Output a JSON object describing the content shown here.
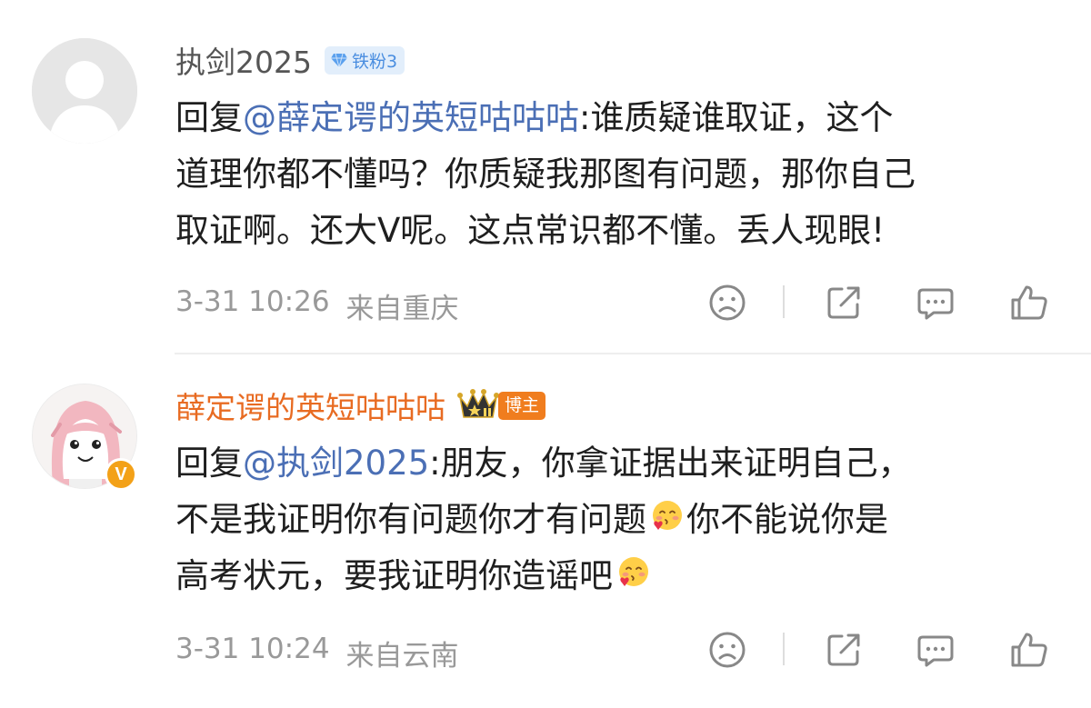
{
  "comments": [
    {
      "username": "执剑2025",
      "fan_badge": "铁粉3",
      "mention_prefix": "回复",
      "mention": "@薛定谔的英短咕咕咕",
      "lines": [
        ":谁质疑谁取证，这个",
        "道理你都不懂吗？你质疑我那图有问题，那你自己",
        "取证啊。还大V呢。这点常识都不懂。丢人现眼!"
      ],
      "time": "3-31 10:26",
      "location": "来自重庆"
    },
    {
      "username": "薛定谔的英短咕咕咕",
      "role_badge": "博主",
      "verified_mark": "V",
      "mention_prefix": "回复",
      "mention": "@执剑2025",
      "lines": [
        ":朋友，你拿证据出来证明自己，",
        "不是我证明你有问题你才有问题",
        "你不能说你是",
        "高考状元，要我证明你造谣吧"
      ],
      "time": "3-31 10:24",
      "location": "来自云南"
    }
  ],
  "icons": {
    "avatar_default": "default-avatar-icon",
    "gem": "diamond-icon",
    "crown": "crown-icon",
    "dislike": "sad-face-icon",
    "share": "share-icon",
    "reply": "comment-icon",
    "like": "thumbs-up-icon",
    "emoji": "blush-kiss-emoji-icon"
  },
  "colors": {
    "mention": "#4b6fb5",
    "blogger_name": "#e86b22",
    "fan_badge_bg": "#e2eefb",
    "fan_badge_text": "#4a8ee0",
    "role_badge_bg": "#f07d1e",
    "verified_bg": "#f3a118",
    "meta": "#999999"
  }
}
